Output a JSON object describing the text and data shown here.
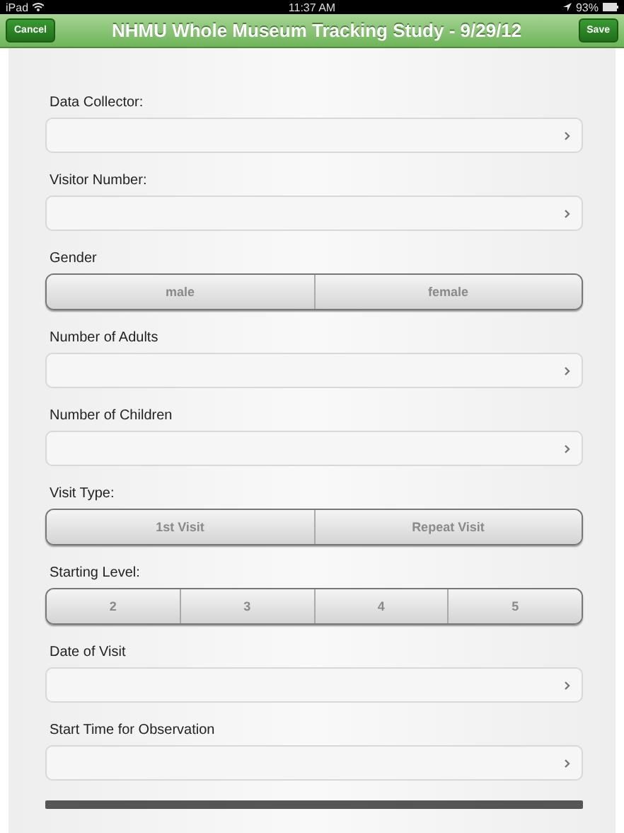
{
  "status_bar": {
    "device": "iPad",
    "time": "11:37 AM",
    "battery": "93%"
  },
  "nav_bar": {
    "title": "NHMU Whole Museum Tracking Study - 9/29/12",
    "left_button": "Cancel",
    "right_button": "Save"
  },
  "fields": [
    {
      "kind": "picker",
      "label": "Data Collector:"
    },
    {
      "kind": "picker",
      "label": "Visitor Number:"
    },
    {
      "kind": "segmented",
      "label": "Gender",
      "options": [
        {
          "label": "male",
          "selected": false
        },
        {
          "label": "female",
          "selected": false
        }
      ]
    },
    {
      "kind": "picker",
      "label": "Number of Adults"
    },
    {
      "kind": "picker",
      "label": "Number of Children"
    },
    {
      "kind": "segmented",
      "label": "Visit Type:",
      "options": [
        {
          "label": "1st Visit",
          "selected": false
        },
        {
          "label": "Repeat Visit",
          "selected": false
        }
      ]
    },
    {
      "kind": "segmented",
      "label": "Starting Level:",
      "options": [
        {
          "label": "2",
          "selected": false
        },
        {
          "label": "3",
          "selected": false
        },
        {
          "label": "4",
          "selected": false
        },
        {
          "label": "5",
          "selected": false
        }
      ]
    },
    {
      "kind": "picker",
      "label": "Date of Visit"
    },
    {
      "kind": "picker",
      "label": "Start Time for Observation"
    }
  ]
}
